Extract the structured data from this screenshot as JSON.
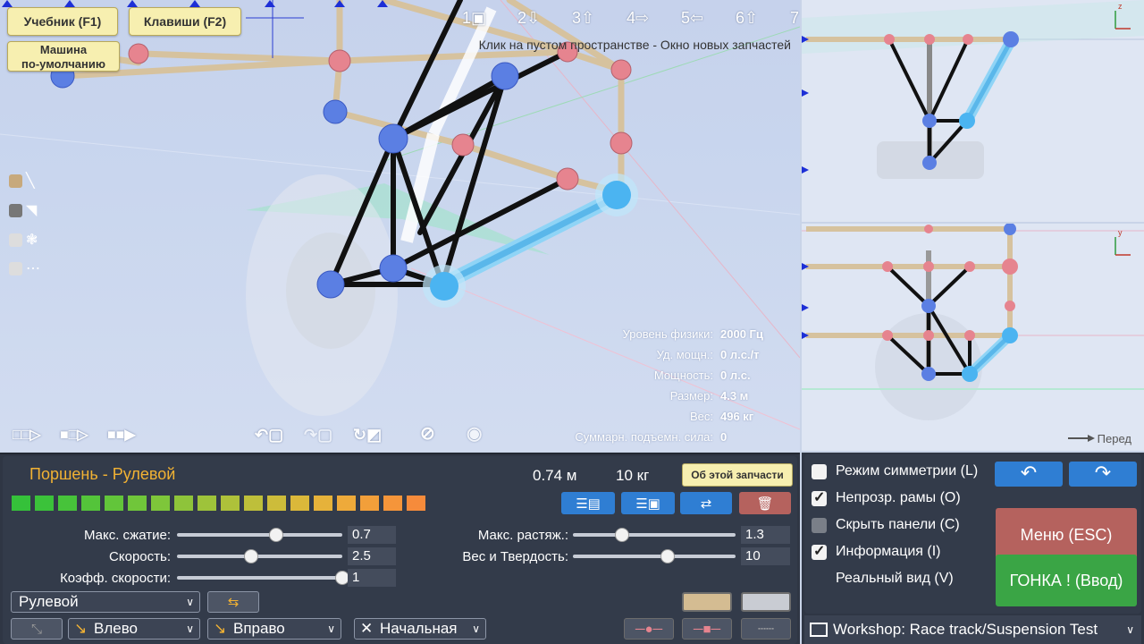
{
  "help": {
    "tutorial": "Учебник (F1)",
    "keys": "Клавиши (F2)",
    "default_car": "Машина\nпо-умолчанию"
  },
  "view_tabs": [
    "1",
    "2",
    "3",
    "4",
    "5",
    "6",
    "7"
  ],
  "hint": "Клик на пустом пространстве - Окно новых запчастей",
  "stats": [
    {
      "label": "Уровень физики:",
      "value": "2000 Гц"
    },
    {
      "label": "Уд. мощн.:",
      "value": "0 л.с./т"
    },
    {
      "label": "Мощность:",
      "value": "0 л.с."
    },
    {
      "label": "Размер:",
      "value": "4.3 м"
    },
    {
      "label": "Вес:",
      "value": "496 кг"
    },
    {
      "label": "Суммарн. подъемн. сила:",
      "value": "0"
    }
  ],
  "front_label": "Перед",
  "part": {
    "title": "Поршень - Рулевой",
    "length": "0.74 м",
    "weight": "10 кг",
    "about": "Об этой запчасти",
    "stiffness_colors": [
      "#35c13a",
      "#3bc23a",
      "#47c33a",
      "#54c43a",
      "#62c53a",
      "#70c63a",
      "#7ec63a",
      "#8ec43a",
      "#9ec33a",
      "#aec13a",
      "#bebf3a",
      "#cdbc3a",
      "#dbb83a",
      "#e6b23a",
      "#eeaa3a",
      "#f29f3a",
      "#f5953a",
      "#f68b3b"
    ],
    "sliders": [
      {
        "label": "Макс. сжатие:",
        "value": "0.7",
        "level": 0.6
      },
      {
        "label": "Скорость:",
        "value": "2.5",
        "level": 0.45
      },
      {
        "label": "Коэфф. скорости:",
        "value": "1",
        "level": 1.0
      },
      {
        "label": "Макс. растяж.:",
        "value": "1.3",
        "level": 0.3
      },
      {
        "label": "Вес и Твердость:",
        "value": "10",
        "level": 0.58
      }
    ],
    "mode_select": "Рулевой",
    "left_select": "Влево",
    "right_select": "Вправо",
    "start_select": "Начальная"
  },
  "settings": {
    "options": [
      {
        "label": "Режим симметрии (L)",
        "checked": false
      },
      {
        "label": "Непрозр. рамы (O)",
        "checked": true
      },
      {
        "label": "Скрыть панели (C)",
        "checked": false
      },
      {
        "label": "Информация (I)",
        "checked": true
      },
      {
        "label": "Реальный вид (V)",
        "checked": null
      }
    ],
    "menu": "Меню (ESC)",
    "race": "ГОНКА ! (Ввод)"
  },
  "workshop": "Workshop:  Race track/Suspension Test",
  "colors": {
    "accent_title": "#f2b233",
    "menu_button": "#b5625e",
    "race_button": "#3aa545",
    "blue_button": "#2f7ed3"
  }
}
